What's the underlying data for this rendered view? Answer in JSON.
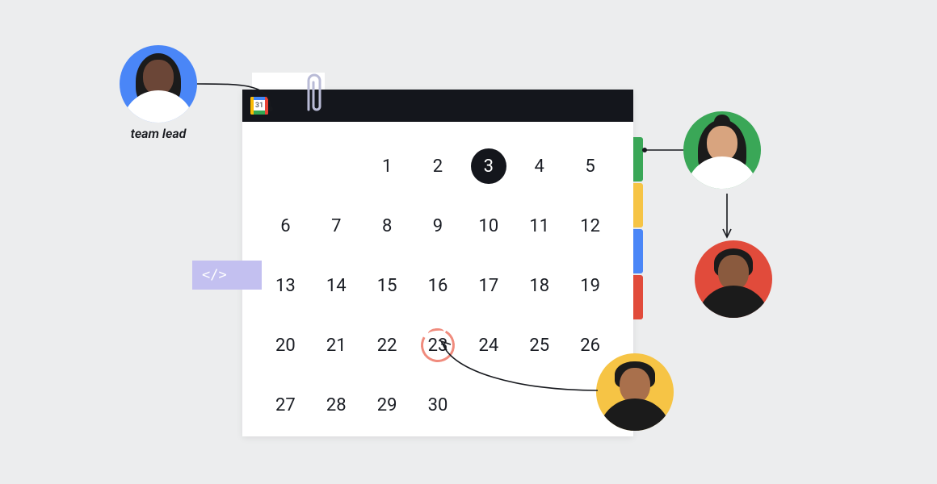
{
  "avatars": {
    "lead_label": "team lead"
  },
  "calendar": {
    "app_icon_day": "31",
    "selected_day": 3,
    "circled_day": 23,
    "days": [
      [
        "",
        "",
        "1",
        "2",
        "3",
        "4",
        "5"
      ],
      [
        "6",
        "7",
        "8",
        "9",
        "10",
        "11",
        "12"
      ],
      [
        "13",
        "14",
        "15",
        "16",
        "17",
        "18",
        "19"
      ],
      [
        "20",
        "21",
        "22",
        "23",
        "24",
        "25",
        "26"
      ],
      [
        "27",
        "28",
        "29",
        "30",
        "",
        "",
        ""
      ]
    ]
  },
  "code_tag": {
    "label": "</>"
  },
  "colors": {
    "tab_green": "#3aa757",
    "tab_yellow": "#f6c445",
    "tab_blue": "#4a86f7",
    "tab_red": "#e14b3b",
    "accent_circle": "#f08b7d",
    "code_bg": "#c3c0f0"
  }
}
